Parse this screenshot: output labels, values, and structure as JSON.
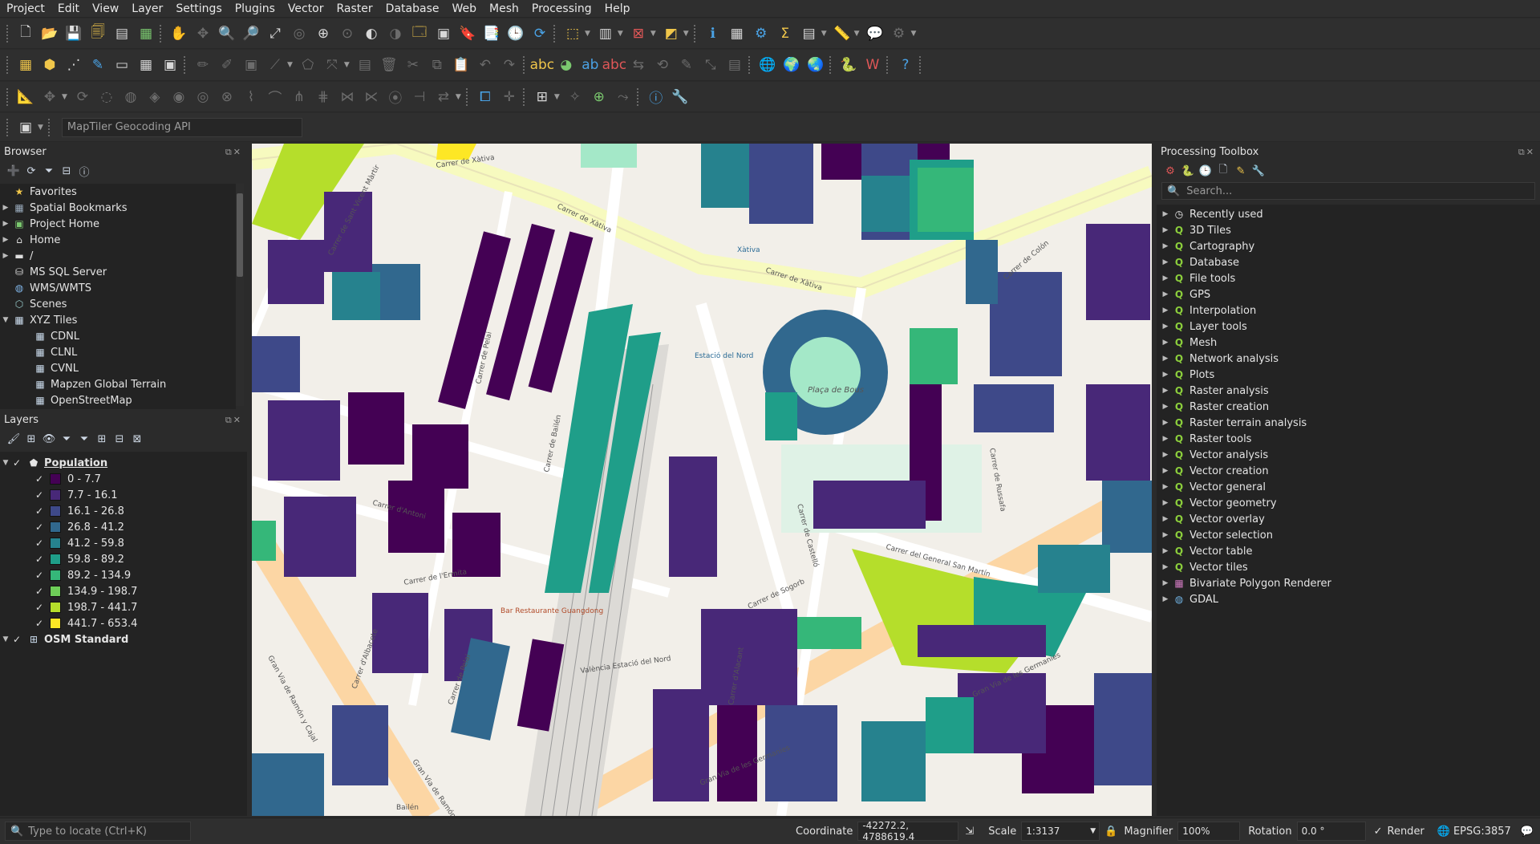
{
  "menu": [
    "Project",
    "Edit",
    "View",
    "Layer",
    "Settings",
    "Plugins",
    "Vector",
    "Raster",
    "Database",
    "Web",
    "Mesh",
    "Processing",
    "Help"
  ],
  "locator_toolbar": {
    "placeholder": "MapTiler Geocoding API"
  },
  "browser": {
    "title": "Browser",
    "items": [
      {
        "label": "Favorites",
        "icon": "star-icon",
        "expand": false,
        "indent": 0
      },
      {
        "label": "Spatial Bookmarks",
        "icon": "bookmark-icon",
        "expand": true,
        "indent": 0
      },
      {
        "label": "Project Home",
        "icon": "project-home-icon",
        "expand": true,
        "indent": 0
      },
      {
        "label": "Home",
        "icon": "home-folder-icon",
        "expand": true,
        "indent": 0
      },
      {
        "label": "/",
        "icon": "folder-icon",
        "expand": true,
        "indent": 0
      },
      {
        "label": "MS SQL Server",
        "icon": "mssql-icon",
        "expand": false,
        "indent": 0
      },
      {
        "label": "WMS/WMTS",
        "icon": "globe-icon",
        "expand": false,
        "indent": 0
      },
      {
        "label": "Scenes",
        "icon": "scenes-icon",
        "expand": false,
        "indent": 0
      },
      {
        "label": "XYZ Tiles",
        "icon": "xyz-tiles-icon",
        "expand": true,
        "expanded": true,
        "indent": 0
      },
      {
        "label": "CDNL",
        "icon": "tile-grid-icon",
        "indent": 1
      },
      {
        "label": "CLNL",
        "icon": "tile-grid-icon",
        "indent": 1
      },
      {
        "label": "CVNL",
        "icon": "tile-grid-icon",
        "indent": 1
      },
      {
        "label": "Mapzen Global Terrain",
        "icon": "tile-grid-icon",
        "indent": 1
      },
      {
        "label": "OpenStreetMap",
        "icon": "tile-grid-icon",
        "indent": 1
      }
    ]
  },
  "layers": {
    "title": "Layers",
    "population_layer": "Population",
    "classes": [
      {
        "label": "0 - 7.7",
        "color": "#440154"
      },
      {
        "label": "7.7 - 16.1",
        "color": "#482878"
      },
      {
        "label": "16.1 - 26.8",
        "color": "#3e4989"
      },
      {
        "label": "26.8 - 41.2",
        "color": "#31688e"
      },
      {
        "label": "41.2 - 59.8",
        "color": "#26828e"
      },
      {
        "label": "59.8 - 89.2",
        "color": "#1f9e89"
      },
      {
        "label": "89.2 - 134.9",
        "color": "#35b779"
      },
      {
        "label": "134.9 - 198.7",
        "color": "#6ece58"
      },
      {
        "label": "198.7 - 441.7",
        "color": "#b5de2b"
      },
      {
        "label": "441.7 - 653.4",
        "color": "#fde725"
      }
    ],
    "base_layer": "OSM Standard"
  },
  "processing": {
    "title": "Processing Toolbox",
    "search_placeholder": "Search...",
    "items": [
      {
        "label": "Recently used",
        "icon": "clock-icon"
      },
      {
        "label": "3D Tiles",
        "icon": "qgis-icon"
      },
      {
        "label": "Cartography",
        "icon": "qgis-icon"
      },
      {
        "label": "Database",
        "icon": "qgis-icon"
      },
      {
        "label": "File tools",
        "icon": "qgis-icon"
      },
      {
        "label": "GPS",
        "icon": "qgis-icon"
      },
      {
        "label": "Interpolation",
        "icon": "qgis-icon"
      },
      {
        "label": "Layer tools",
        "icon": "qgis-icon"
      },
      {
        "label": "Mesh",
        "icon": "qgis-icon"
      },
      {
        "label": "Network analysis",
        "icon": "qgis-icon"
      },
      {
        "label": "Plots",
        "icon": "qgis-icon"
      },
      {
        "label": "Raster analysis",
        "icon": "qgis-icon"
      },
      {
        "label": "Raster creation",
        "icon": "qgis-icon"
      },
      {
        "label": "Raster terrain analysis",
        "icon": "qgis-icon"
      },
      {
        "label": "Raster tools",
        "icon": "qgis-icon"
      },
      {
        "label": "Vector analysis",
        "icon": "qgis-icon"
      },
      {
        "label": "Vector creation",
        "icon": "qgis-icon"
      },
      {
        "label": "Vector general",
        "icon": "qgis-icon"
      },
      {
        "label": "Vector geometry",
        "icon": "qgis-icon"
      },
      {
        "label": "Vector overlay",
        "icon": "qgis-icon"
      },
      {
        "label": "Vector selection",
        "icon": "qgis-icon"
      },
      {
        "label": "Vector table",
        "icon": "qgis-icon"
      },
      {
        "label": "Vector tiles",
        "icon": "qgis-icon"
      },
      {
        "label": "Bivariate Polygon Renderer",
        "icon": "bivariate-icon"
      },
      {
        "label": "GDAL",
        "icon": "gdal-icon"
      }
    ]
  },
  "map": {
    "streets": [
      "Carrer de Xàtiva",
      "Carrer de Xàtiva",
      "Carrer de Xàtiva",
      "Carrer de Colón",
      "Carrer de Russafa",
      "Carrer de Sogorb",
      "Carrer del General San Martín",
      "Gran Via de les Germanies",
      "Gran Via de Ramón y Cajal",
      "Carrer de Bailén",
      "Carrer de Pelai",
      "Carrer de Castelló",
      "Carrer d'Alacant",
      "Carrer de l'Ermita",
      "Carrer de Sant Vicent Màrtir",
      "Gran Via de les Germanies",
      "Carrer de Pelai",
      "Carrer d'Albacete",
      "Carrer d'Antoni"
    ],
    "places": [
      "Plaça de Bous",
      "Estació del Nord",
      "València Estació del Nord",
      "Xàtiva",
      "Bar Restaurante Guangdong",
      "Gran Via de Ramón y Cajal",
      "Bailén"
    ]
  },
  "status": {
    "locate_placeholder": "Type to locate (Ctrl+K)",
    "coordinate_label": "Coordinate",
    "coordinate_value": "-42272.2, 4788619.4",
    "scale_label": "Scale",
    "scale_value": "1:3137",
    "magnifier_label": "Magnifier",
    "magnifier_value": "100%",
    "rotation_label": "Rotation",
    "rotation_value": "0.0 °",
    "render_label": "Render",
    "crs": "EPSG:3857"
  }
}
